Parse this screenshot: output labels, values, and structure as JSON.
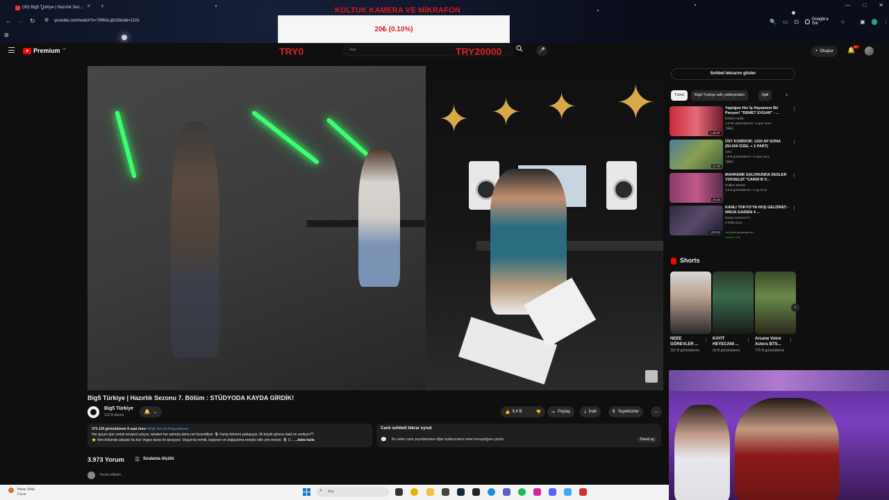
{
  "browser": {
    "tab_title": "(30) Big5 Türkiye | Hazırlık Sez...",
    "url": "youtube.com/watch?v=78WsLqtUGbo&t=110s",
    "google_ask_label": "Google'a Sor"
  },
  "overlay": {
    "donation_title": "KOLTUK KAMERA VE MİKRAFON",
    "donation_value": "20₺ (0.10%)",
    "try_left": "TRY0",
    "try_right": "TRY20000"
  },
  "header": {
    "logo_text": "Premium",
    "logo_region": "TR",
    "search_placeholder": "Ara",
    "create_label": "Oluştur",
    "notification_count": "9+"
  },
  "video": {
    "title": "Big5 Türkiye | Hazırlık Sezonu 7. Bölüm : STÜDYODA KAYDA GİRDİK!",
    "channel_name": "Big5 Türkiye",
    "channel_subs": "313 B abone",
    "actions": {
      "like_count": "9,4 B",
      "share_label": "Paylaş",
      "download_label": "İndir",
      "thanks_label": "Teşekkürler"
    },
    "description": {
      "meta": "373.129 görüntüleme  9 saat önce",
      "tags": "#big5 #vocal #voguedance",
      "line1": "Her geçen gün zorluk seviyesi artıyor, rekabet her adımda daha net hissediliyor 🎙️ Kamp dönemi yaklaşıyor, ilk büyük göreve start mı veriliyor??",
      "line2": "⭐ Yeni bölümde adaylar bu kez Vogue dansı ile tanışıyor. Vogue'da mimik, özgüven ve doğaçlama enerjisi stile yön veriyor. 🎙️ D...",
      "more": "...daha fazla"
    },
    "live_chat": {
      "title": "Canlı sohbeti tekrar oynat",
      "desc": "Bu video canlı yayınlanırken diğer kullanıcıların neler konuştuğunu görün.",
      "open_label": "Paneli aç"
    },
    "comments": {
      "count_label": "3.973 Yorum",
      "sort_label": "Sıralama ölçütü",
      "add_placeholder": "Yorum ekleyin..."
    }
  },
  "sidebar": {
    "chat_replay_label": "Sohbet tekrarını göster",
    "chips": [
      {
        "label": "Tümü",
        "active": true
      },
      {
        "label": "Big5 Türkiye adlı yükleyiciden",
        "active": false
      },
      {
        "label": "İlgili",
        "active": false
      }
    ],
    "recommendations": [
      {
        "title": "Yaptığım Her İş Hayatımın Bir Parçası! \"DEMET EVGAR\" - ...",
        "channel": "İbrahim Selim",
        "meta": "1,6 Mn görüntüleme • 4 gün önce",
        "badge": "Yeni",
        "duration": "1:46:07"
      },
      {
        "title": "ÜST KORİDOR: 1100 AP SONA (50.000 ÖZEL + 2 PART)",
        "channel": "Adro",
        "meta": "7,9 B görüntüleme • 2 saat önce",
        "badge": "Yeni",
        "duration": "21:23"
      },
      {
        "title": "MAHKEME SALONUNDA SESLER YÜKSELDİ \"CARDI B V...",
        "channel": "Doğlan Barlası",
        "meta": "2,8 B görüntüleme • 1 ay önce",
        "badge": "",
        "duration": "15:43"
      },
      {
        "title": "KANLI TOKYO'YA HOŞ GELDİNİZ! - NINJA GAIDEN 4 ...",
        "channel": "Easter GamersTV",
        "meta": "3 hafta önce",
        "badge": "YouTube tarafından ön...",
        "badge2": "Üyelere özel",
        "duration": "1:03:23"
      }
    ],
    "shorts_label": "Shorts",
    "shorts": [
      {
        "title": "NEEE GÖREVLER ...",
        "views": "101 B görüntüleme"
      },
      {
        "title": "KAYIT HEYECANI ...",
        "views": "93 B görüntüleme"
      },
      {
        "title": "Arcane Voice Actors BTS...",
        "views": "770 B görüntüleme"
      }
    ]
  },
  "taskbar": {
    "weather_l1": "Hava: Kötü",
    "weather_l2": "Pazar",
    "search_placeholder": "Ara"
  },
  "colors": {
    "accent_red": "#d92424",
    "youtube_red": "#ff0000",
    "background": "#0f0f0f",
    "neon_green": "#3cff6e"
  }
}
